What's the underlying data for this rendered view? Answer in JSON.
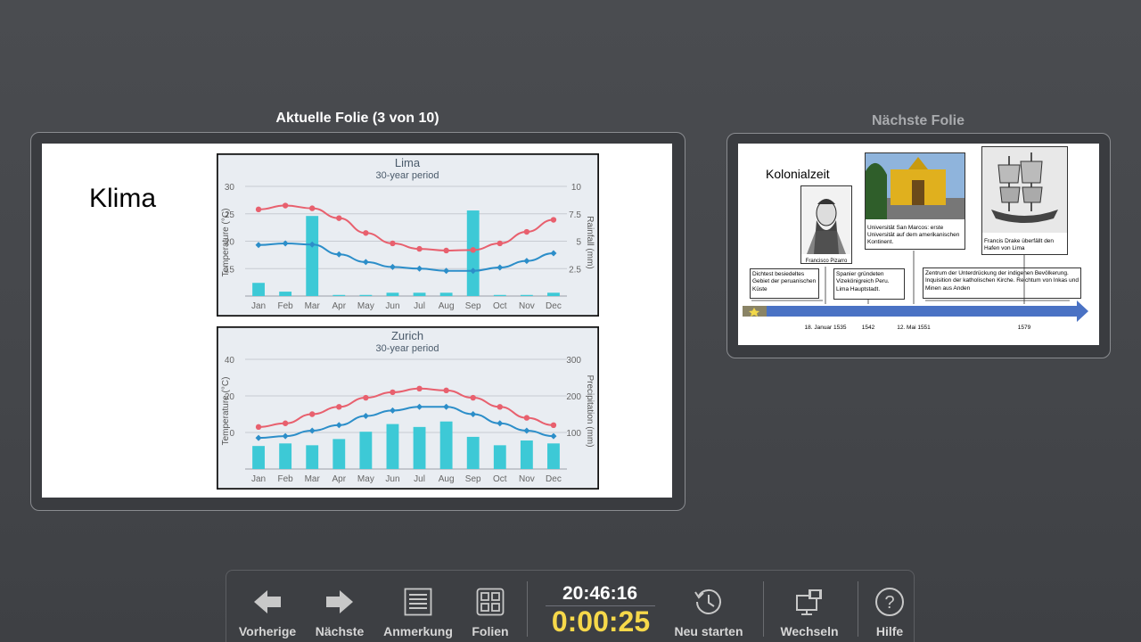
{
  "current_panel": {
    "title": "Aktuelle Folie (3 von 10)",
    "slide": {
      "heading": "Klima",
      "charts": {
        "lima": {
          "title": "Lima",
          "subtitle": "30-year period",
          "ylabel": "Temperature (°C)",
          "y2label": "Rainfall (mm)"
        },
        "zurich": {
          "title": "Zurich",
          "subtitle": "30-year period",
          "ylabel": "Temperature (°C)",
          "y2label": "Precipitation (mm)"
        }
      }
    }
  },
  "next_panel": {
    "title": "Nächste Folie",
    "slide": {
      "heading": "Kolonialzeit",
      "captions": {
        "pizarro": "Francisco Pizarro",
        "university": "Universität San Marcos: erste Universität auf dem amerikanischen Kontinent.",
        "drake": "Francis Drake überfällt den Hafen von Lima",
        "gebiet": "Dichtest besiedeltes Gebiet der peruanischen Küste",
        "spanier": "Spanier gründeten Vizekönigreich Peru. Lima Hauptstadt.",
        "zentrum": "Zentrum der Unterdrückung der indigenen Bevölkerung. Inquisition der katholischen Kirche. Reichtum von Inkas und Minen aus Anden"
      },
      "timeline_labels": [
        "18. Januar 1535",
        "1542",
        "12. Mai 1551",
        "1579"
      ]
    }
  },
  "toolbar": {
    "prev": "Vorherige",
    "next": "Nächste",
    "note": "Anmerkung",
    "slides": "Folien",
    "clock": "20:46:16",
    "timer": "0:00:25",
    "restart": "Neu starten",
    "switch": "Wechseln",
    "help": "Hilfe"
  },
  "chart_data": [
    {
      "type": "bar",
      "title": "Lima",
      "subtitle": "30-year period",
      "categories": [
        "Jan",
        "Feb",
        "Mar",
        "Apr",
        "May",
        "Jun",
        "Jul",
        "Aug",
        "Sep",
        "Oct",
        "Nov",
        "Dec"
      ],
      "ylabel": "Temperature (°C)",
      "y2label": "Rainfall (mm)",
      "yticks": [
        15,
        20,
        25,
        30
      ],
      "y2ticks": [
        2.5,
        5,
        7.5,
        10
      ],
      "ylim": [
        10,
        30
      ],
      "y2lim": [
        0,
        10
      ],
      "series": [
        {
          "kind": "line",
          "axis": "left",
          "color": "#e8606e",
          "values": [
            25.8,
            26.5,
            26.0,
            24.2,
            21.5,
            19.6,
            18.6,
            18.3,
            18.4,
            19.6,
            21.7,
            23.9
          ]
        },
        {
          "kind": "line",
          "axis": "left",
          "color": "#2c8ec9",
          "values": [
            19.3,
            19.6,
            19.4,
            17.6,
            16.2,
            15.3,
            15.0,
            14.6,
            14.6,
            15.2,
            16.4,
            17.8
          ]
        },
        {
          "kind": "bar",
          "axis": "right",
          "color": "#3dc9d6",
          "values": [
            1.2,
            0.4,
            7.3,
            0.1,
            0.1,
            0.3,
            0.3,
            0.3,
            7.8,
            0.1,
            0.1,
            0.3
          ]
        }
      ]
    },
    {
      "type": "bar",
      "title": "Zurich",
      "subtitle": "30-year period",
      "categories": [
        "Jan",
        "Feb",
        "Mar",
        "Apr",
        "May",
        "Jun",
        "Jul",
        "Aug",
        "Sep",
        "Oct",
        "Nov",
        "Dec"
      ],
      "ylabel": "Temperature (°C)",
      "y2label": "Precipitation (mm)",
      "yticks": [
        0,
        20,
        40
      ],
      "y2ticks": [
        100,
        200,
        300
      ],
      "ylim": [
        -20,
        40
      ],
      "y2lim": [
        0,
        300
      ],
      "series": [
        {
          "kind": "line",
          "axis": "left",
          "color": "#e8606e",
          "values": [
            3,
            5,
            10,
            14,
            19,
            22,
            24,
            23,
            19,
            14,
            8,
            4
          ]
        },
        {
          "kind": "line",
          "axis": "left",
          "color": "#2c8ec9",
          "values": [
            -3,
            -2,
            1,
            4,
            9,
            12,
            14,
            14,
            10,
            5,
            1,
            -2
          ]
        },
        {
          "kind": "bar",
          "axis": "right",
          "color": "#3dc9d6",
          "values": [
            63,
            70,
            65,
            82,
            102,
            123,
            115,
            130,
            88,
            65,
            78,
            70
          ]
        }
      ]
    }
  ]
}
